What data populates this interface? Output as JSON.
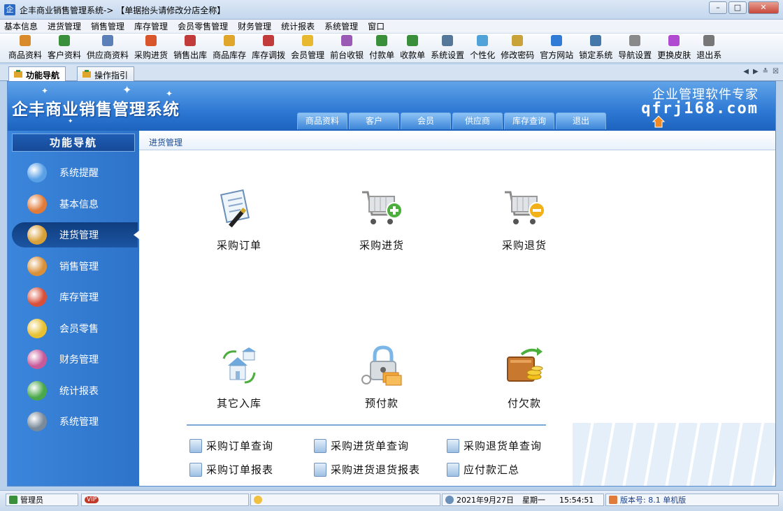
{
  "window": {
    "title": "企丰商业销售管理系统-> 【单据抬头请修改分店全称】",
    "icon": "企"
  },
  "menu": [
    "基本信息",
    "进货管理",
    "销售管理",
    "库存管理",
    "会员零售管理",
    "财务管理",
    "统计报表",
    "系统管理",
    "窗口"
  ],
  "toolbar": [
    {
      "label": "商品资料",
      "icon": "box-icon",
      "color": "#d98a2b"
    },
    {
      "label": "客户资料",
      "icon": "customers-icon",
      "color": "#3a8f3a"
    },
    {
      "label": "供应商资料",
      "icon": "suppliers-icon",
      "color": "#5b7fb8"
    },
    {
      "label": "采购进货",
      "icon": "purchase-icon",
      "color": "#d9552b"
    },
    {
      "label": "销售出库",
      "icon": "sale-icon",
      "color": "#c23b3b"
    },
    {
      "label": "商品库存",
      "icon": "stock-icon",
      "color": "#e0a52b"
    },
    {
      "label": "库存调拨",
      "icon": "transfer-icon",
      "color": "#c23b3b"
    },
    {
      "label": "会员管理",
      "icon": "member-icon",
      "color": "#e8b830"
    },
    {
      "label": "前台收银",
      "icon": "cashier-icon",
      "color": "#9b59b6"
    },
    {
      "label": "付款单",
      "icon": "pay-icon",
      "color": "#3a8f3a"
    },
    {
      "label": "收款单",
      "icon": "receive-icon",
      "color": "#3a8f3a"
    },
    {
      "label": "系统设置",
      "icon": "settings-icon",
      "color": "#557799"
    },
    {
      "label": "个性化",
      "icon": "personalize-icon",
      "color": "#4fa3d9"
    },
    {
      "label": "修改密码",
      "icon": "key-icon",
      "color": "#c9a23a"
    },
    {
      "label": "官方网站",
      "icon": "ie-icon",
      "color": "#2f7bd6"
    },
    {
      "label": "锁定系统",
      "icon": "lock-icon",
      "color": "#4477aa"
    },
    {
      "label": "导航设置",
      "icon": "nav-icon",
      "color": "#8a8a8a"
    },
    {
      "label": "更换皮肤",
      "icon": "skin-icon",
      "color": "#b04ad1"
    },
    {
      "label": "退出系",
      "icon": "exit-icon",
      "color": "#777777"
    }
  ],
  "tabs": [
    {
      "label": "功能导航",
      "active": true
    },
    {
      "label": "操作指引",
      "active": false
    }
  ],
  "banner": {
    "brand": "企丰商业销售管理系统",
    "slogan": "企业管理软件专家",
    "site": "qfrj168.com",
    "quick_tabs": [
      "商品资料",
      "客户",
      "会员",
      "供应商",
      "库存查询",
      "退出"
    ]
  },
  "sidebar": {
    "title": "功能导航",
    "items": [
      {
        "label": "系统提醒",
        "icon": "info-icon",
        "color": "#5aa0e6"
      },
      {
        "label": "基本信息",
        "icon": "boxes-icon",
        "color": "#e07b39"
      },
      {
        "label": "进货管理",
        "icon": "package-in-icon",
        "color": "#d9a038",
        "active": true
      },
      {
        "label": "销售管理",
        "icon": "package-out-icon",
        "color": "#d99038"
      },
      {
        "label": "库存管理",
        "icon": "warehouse-icon",
        "color": "#d9503a"
      },
      {
        "label": "会员零售",
        "icon": "members-icon",
        "color": "#e8c030"
      },
      {
        "label": "财务管理",
        "icon": "finance-icon",
        "color": "#c95a9a"
      },
      {
        "label": "统计报表",
        "icon": "bar-chart-icon",
        "color": "#4aa84a"
      },
      {
        "label": "系统管理",
        "icon": "tools-icon",
        "color": "#7a8a9a"
      }
    ]
  },
  "content": {
    "header": "进货管理",
    "functions": [
      {
        "label": "采购订单",
        "icon": "order-doc-icon"
      },
      {
        "label": "采购进货",
        "icon": "cart-add-icon"
      },
      {
        "label": "采购退货",
        "icon": "cart-remove-icon"
      },
      {
        "label": "其它入库",
        "icon": "house-exchange-icon"
      },
      {
        "label": "预付款",
        "icon": "lock-money-icon"
      },
      {
        "label": "付欠款",
        "icon": "wallet-coins-icon"
      }
    ],
    "links": [
      {
        "label": "采购订单查询"
      },
      {
        "label": "采购进货单查询"
      },
      {
        "label": "采购退货单查询"
      },
      {
        "label": "采购订单报表"
      },
      {
        "label": "采购进货退货报表"
      },
      {
        "label": "应付款汇总"
      }
    ]
  },
  "status": {
    "user": "管理员",
    "vip": "VIP",
    "date": "2021年9月27日",
    "weekday": "星期一",
    "time": "15:54:51",
    "version": "版本号: 8.1 单机版"
  }
}
